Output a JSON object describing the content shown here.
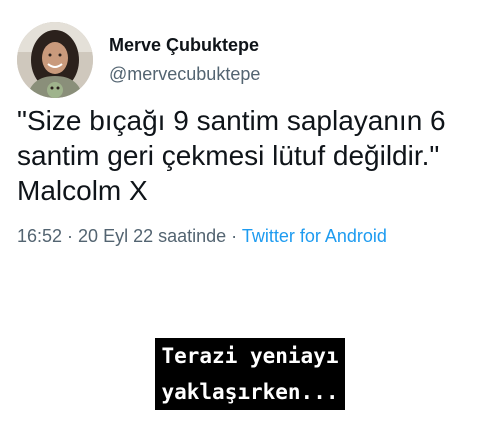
{
  "tweet": {
    "author_name": "Merve Çubuktepe",
    "handle": "@mervecubuktepe",
    "text_lines": [
      "\"Size bıçağı 9 santim saplayanın 6",
      "santim geri çekmesi lütuf değildir.\"",
      "Malcolm X"
    ],
    "time": "16:52",
    "separator": " · ",
    "date": "20 Eyl 22 saatinde",
    "source": "Twitter for Android"
  },
  "caption": {
    "lines": [
      "Terazi yeniayı",
      "yaklaşırken..."
    ]
  },
  "colors": {
    "text": "#0f1419",
    "secondary": "#536471",
    "link": "#1d9bf0",
    "caption_bg": "#000000",
    "caption_text": "#ffffff"
  }
}
